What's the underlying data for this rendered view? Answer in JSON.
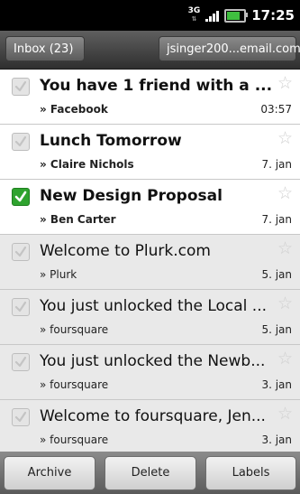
{
  "status_bar": {
    "network_label": "3G",
    "time": "17:25",
    "battery_level": 0.85
  },
  "header": {
    "inbox_tab": "Inbox (23)",
    "account_tab": "jsinger200...email.com"
  },
  "messages": [
    {
      "subject": "You have 1 friend with a ...",
      "subject_suffix": " -...",
      "sender": "» Facebook",
      "date": "03:57",
      "unread": true,
      "checked": false
    },
    {
      "subject": "Lunch Tomorrow",
      "subject_suffix": "",
      "sender": "» Claire Nichols",
      "date": "7. jan",
      "unread": true,
      "checked": false
    },
    {
      "subject": "New Design Proposal",
      "subject_suffix": "",
      "sender": "» Ben Carter",
      "date": "7. jan",
      "unread": true,
      "checked": true
    },
    {
      "subject": "Welcome to Plurk.com",
      "subject_suffix": "",
      "sender": "» Plurk",
      "date": "5. jan",
      "unread": false,
      "checked": false
    },
    {
      "subject": "You just unlocked the Local ...",
      "subject_suffix": "",
      "sender": "» foursquare",
      "date": "5. jan",
      "unread": false,
      "checked": false
    },
    {
      "subject": "You just unlocked the Newb...",
      "subject_suffix": "",
      "sender": "» foursquare",
      "date": "3. jan",
      "unread": false,
      "checked": false
    },
    {
      "subject": "Welcome to foursquare, Jen...",
      "subject_suffix": "",
      "sender": "» foursquare",
      "date": "3. jan",
      "unread": false,
      "checked": false
    }
  ],
  "toolbar": {
    "archive_label": "Archive",
    "delete_label": "Delete",
    "labels_label": "Labels"
  },
  "colors": {
    "checked_green": "#2fa32f",
    "read_row_bg": "#e9e9e9",
    "header_dark": "#2f2f2f"
  },
  "icons": [
    "network-3g-icon",
    "signal-icon",
    "battery-icon",
    "checkbox-icon",
    "star-icon",
    "checkmark-icon"
  ]
}
